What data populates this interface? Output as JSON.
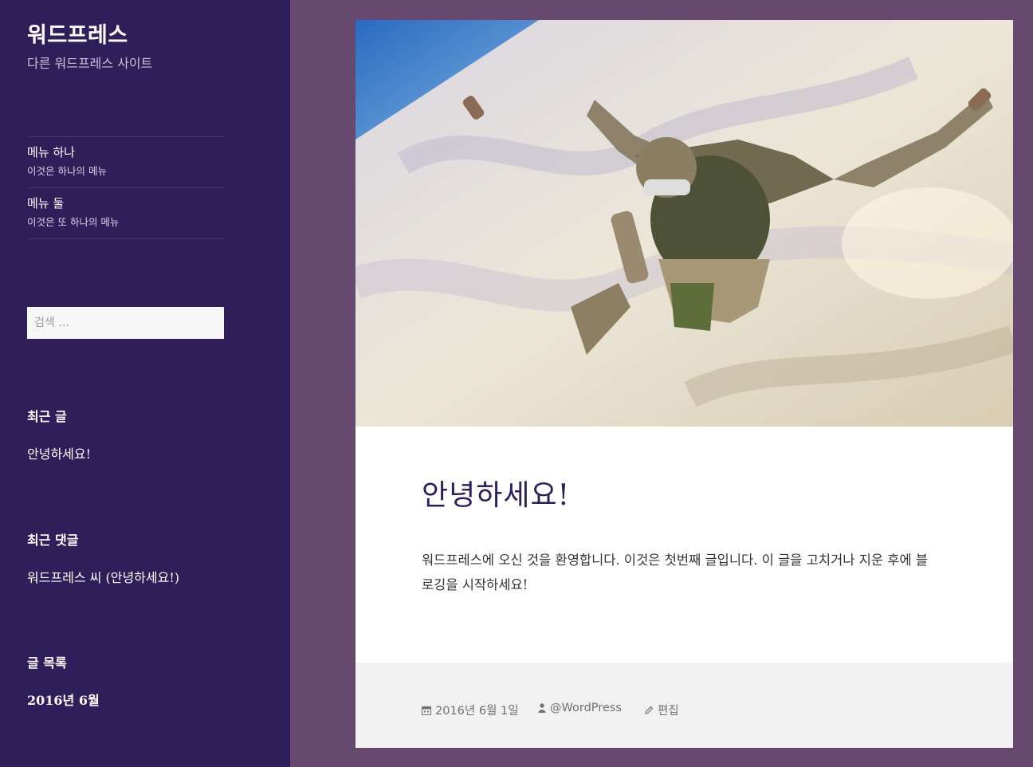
{
  "site": {
    "title": "워드프레스",
    "description": "다른 워드프레스 사이트"
  },
  "menu": {
    "items": [
      {
        "label": "메뉴 하나",
        "description": "이것은 하나의 메뉴"
      },
      {
        "label": "메뉴 둘",
        "description": "이것은 또 하나의 메뉴"
      }
    ]
  },
  "search": {
    "placeholder": "검색 …"
  },
  "widgets": {
    "recent_posts": {
      "title": "최근 글",
      "items": [
        "안녕하세요!"
      ]
    },
    "recent_comments": {
      "title": "최근 댓글",
      "items": [
        "워드프레스 씨 (안녕하세요!)"
      ]
    },
    "archives": {
      "title": "글 목록",
      "items": [
        "2016년 6월"
      ]
    }
  },
  "post": {
    "title": "안녕하세요!",
    "content": "워드프레스에 오신 것을 환영합니다. 이것은 첫번째 글입니다. 이 글을 고치거나 지운 후에 블로깅을 시작하세요!",
    "date": "2016년 6월 1일",
    "author": "@WordPress",
    "edit_label": "편집",
    "image_subject": "skydiver-photo"
  },
  "colors": {
    "sidebar_bg": "#2e1f5b",
    "page_bg": "#674970",
    "title_color": "#2e1f5b",
    "footer_bg": "#f1f1f1"
  },
  "icons": [
    "calendar-icon",
    "user-icon",
    "pencil-icon"
  ]
}
